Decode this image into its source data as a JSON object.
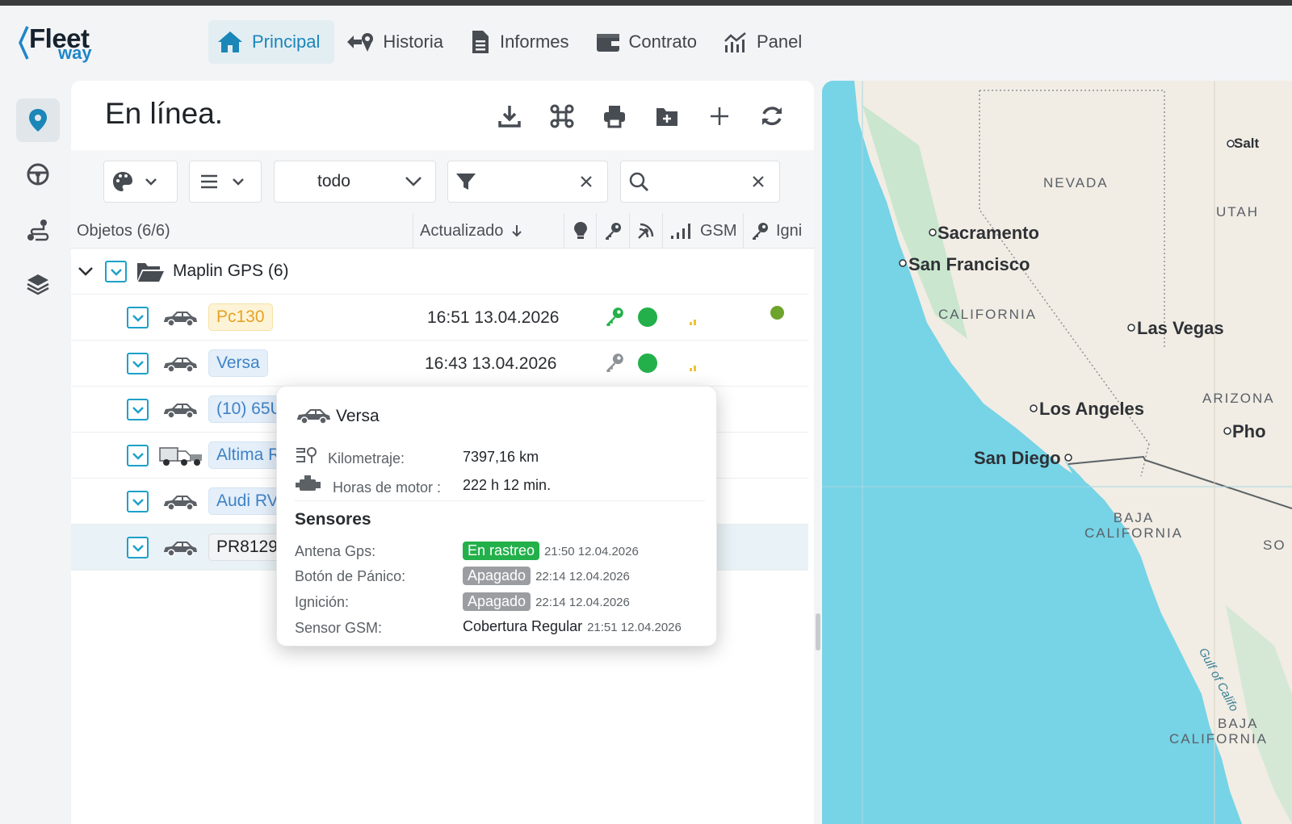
{
  "brand": {
    "fleet": "Fleet",
    "way": "way"
  },
  "nav": [
    {
      "label": "Principal",
      "icon": "home-icon",
      "active": true
    },
    {
      "label": "Historia",
      "icon": "history-icon"
    },
    {
      "label": "Informes",
      "icon": "document-icon"
    },
    {
      "label": "Contrato",
      "icon": "wallet-icon"
    },
    {
      "label": "Panel",
      "icon": "chart-icon"
    }
  ],
  "rail": [
    "map-pin-icon",
    "steering-wheel-icon",
    "route-icon",
    "layers-icon"
  ],
  "panel": {
    "title": "En línea.",
    "toolbar": [
      "download-icon",
      "command-icon",
      "print-icon",
      "folder-plus-icon",
      "plus-icon",
      "refresh-icon"
    ]
  },
  "filters": {
    "dropdown_value": "todo",
    "filter_value": "",
    "search_value": ""
  },
  "columns": {
    "objects": "Objetos (6/6)",
    "updated": "Actualizado",
    "gsm": "GSM",
    "ignition": "Igni"
  },
  "group": {
    "name": "Maplin GPS (6)"
  },
  "rows": [
    {
      "name": "Pc130",
      "time": "16:51 13.04.2026"
    },
    {
      "name": "Versa",
      "time": "16:43 13.04.2026"
    },
    {
      "name": "(10) 65U",
      "time": ""
    },
    {
      "name": "Altima R",
      "time": ""
    },
    {
      "name": "Audi RV",
      "time": ""
    },
    {
      "name": "PR8129",
      "time": ""
    }
  ],
  "popup": {
    "title": "Versa",
    "km_label": "Kilometraje:",
    "km_value": "7397,16 km",
    "hours_label": "Horas de motor :",
    "hours_value": "222 h 12 min.",
    "sensors_title": "Sensores",
    "sensors": [
      {
        "label": "Antena Gps:",
        "value": "En rastreo",
        "kind": "green",
        "date": "21:50 12.04.2026"
      },
      {
        "label": "Botón de Pánico:",
        "value": "Apagado",
        "kind": "gray",
        "date": "22:14 12.04.2026"
      },
      {
        "label": "Ignición:",
        "value": "Apagado",
        "kind": "gray",
        "date": "22:14 12.04.2026"
      },
      {
        "label": "Sensor GSM:",
        "value": "Cobertura Regular",
        "kind": "text",
        "date": "21:51 12.04.2026"
      }
    ]
  },
  "map": {
    "states": [
      "NEVADA",
      "UTAH",
      "CALIFORNIA",
      "ARIZONA",
      "BAJA CALIFORNIA",
      "BAJA",
      "CALIFORNIA",
      "SO"
    ],
    "cities": [
      "Salt",
      "Sacramento",
      "San Francisco",
      "Las Vegas",
      "Los Angeles",
      "Pho",
      "San Diego"
    ],
    "gulf": "Gulf of Califo"
  },
  "colors": {
    "accent": "#1b86b8",
    "green": "#23b04a",
    "sea": "#77d3e6",
    "land": "#f1ede4"
  }
}
